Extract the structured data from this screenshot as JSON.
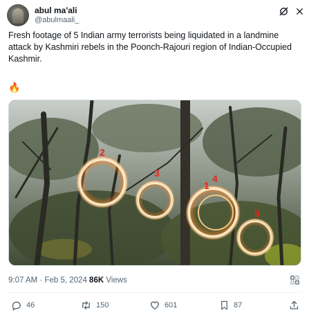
{
  "author": {
    "display_name": "abul ma'ali",
    "handle": "@abulmaali_"
  },
  "header_icons": {
    "grok": "grok-icon",
    "more": "more-icon"
  },
  "tweet": {
    "text": "Fresh footage of 5 Indian army terrorists being liquidated in a landmine attack by Kashmiri rebels in the Poonch-Rajouri region of Indian-Occupied Kashmir.",
    "emoji": "🔥"
  },
  "media": {
    "markers": [
      {
        "label": "2"
      },
      {
        "label": "3"
      },
      {
        "label": "1"
      },
      {
        "label": "4"
      },
      {
        "label": "5"
      }
    ],
    "colors": {
      "ring": "#ffb347",
      "ring_glow": "#ff7a1a",
      "marker": "#e8261b"
    }
  },
  "meta": {
    "time": "9:07 AM",
    "separator": "·",
    "date": "Feb 5, 2024",
    "views_count": "86K",
    "views_label": "Views"
  },
  "actions": {
    "replies": "46",
    "reposts": "150",
    "likes": "601",
    "bookmarks": "87"
  },
  "colors": {
    "text": "#0f1419",
    "muted": "#536471",
    "border": "#eff3f4"
  }
}
